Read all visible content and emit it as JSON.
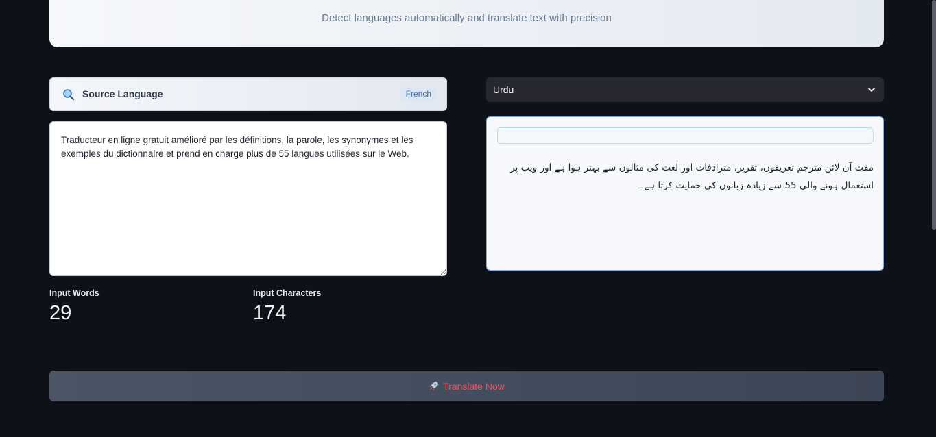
{
  "hero": {
    "subtitle": "Detect languages automatically and translate text with precision"
  },
  "source": {
    "label": "Source Language",
    "detected_language": "French",
    "text": "Traducteur en ligne gratuit amélioré par les définitions, la parole, les synonymes et les exemples du dictionnaire et prend en charge plus de 55 langues utilisées sur le Web."
  },
  "metrics": {
    "words_label": "Input Words",
    "words_value": "29",
    "chars_label": "Input Characters",
    "chars_value": "174"
  },
  "target": {
    "selected_language": "Urdu",
    "translation": "مفت آن لائن مترجم تعریفوں، تقریر، مترادفات اور لغت کی مثالوں سے بہتر ہوا ہے اور ویب پر استعمال ہونے والی 55 سے زیادہ زبانوں کی حمایت کرتا ہے۔"
  },
  "actions": {
    "translate_label": "Translate Now"
  },
  "icons": {
    "source": "magnifier-icon",
    "select": "chevron-down-icon",
    "translate": "rocket-icon"
  },
  "colors": {
    "background": "#0e1117",
    "accent_text": "#f05060",
    "badge_text": "#3d6fb5"
  }
}
